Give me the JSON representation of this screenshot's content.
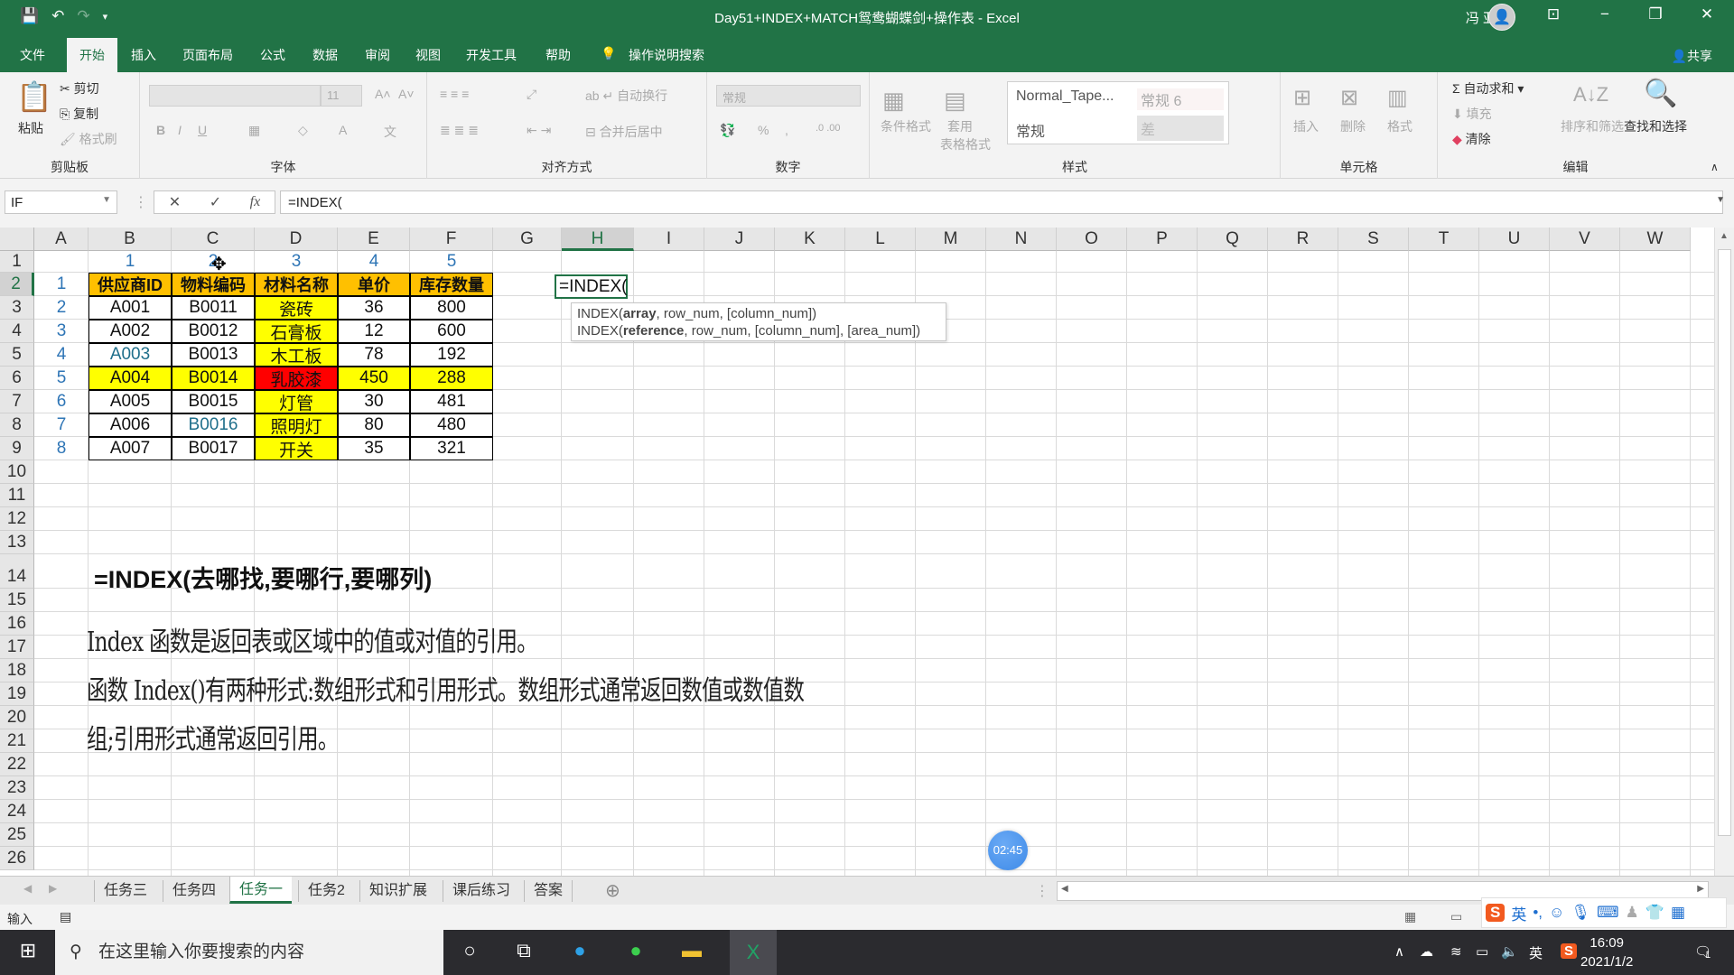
{
  "window": {
    "title": "Day51+INDEX+MATCH鸳鸯蝴蝶剑+操作表  -  Excel",
    "user": "冯 亚萍",
    "share_label": "共享"
  },
  "menu": {
    "tabs": [
      "文件",
      "开始",
      "插入",
      "页面布局",
      "公式",
      "数据",
      "审阅",
      "视图",
      "开发工具",
      "帮助"
    ],
    "active_tab": "开始",
    "search": "操作说明搜索"
  },
  "ribbon": {
    "clipboard": {
      "label": "剪贴板",
      "paste": "粘贴",
      "cut": "剪切",
      "copy": "复制",
      "format_painter": "格式刷"
    },
    "font": {
      "label": "字体",
      "size": "11",
      "bold": "B",
      "italic": "I",
      "underline": "U"
    },
    "alignment": {
      "label": "对齐方式",
      "wrap": "自动换行",
      "merge": "合并后居中"
    },
    "number": {
      "label": "数字",
      "format": "常规",
      "percent": "%",
      "comma": ","
    },
    "styles": {
      "label": "样式",
      "conditional": "条件格式",
      "table_format_1": "套用",
      "table_format_2": "表格格式",
      "style1": "Normal_Tape...",
      "style2": "常规 6",
      "style3": "常规",
      "style4": "差"
    },
    "cells": {
      "label": "单元格",
      "insert": "插入",
      "delete": "删除",
      "format": "格式"
    },
    "editing": {
      "label": "编辑",
      "autosum": "自动求和",
      "fill": "填充",
      "clear": "清除",
      "sort": "排序和筛选",
      "find": "查找和选择"
    }
  },
  "formula_bar": {
    "name_box": "IF",
    "formula": "=INDEX(",
    "fx": "fx"
  },
  "columns": [
    "A",
    "B",
    "C",
    "D",
    "E",
    "F",
    "G",
    "H",
    "I",
    "J",
    "K",
    "L",
    "M",
    "N",
    "O",
    "P",
    "Q",
    "R",
    "S",
    "T",
    "U",
    "V",
    "W"
  ],
  "rows": [
    "1",
    "2",
    "3",
    "4",
    "5",
    "6",
    "7",
    "8",
    "9",
    "10",
    "11",
    "12",
    "13",
    "14",
    "15",
    "16",
    "17",
    "18",
    "19",
    "20",
    "21",
    "22",
    "23",
    "24",
    "25",
    "26"
  ],
  "sheet": {
    "row1_numbers": [
      "1",
      "2",
      "3",
      "4",
      "5"
    ],
    "a_column_numbers": [
      "1",
      "2",
      "3",
      "4",
      "5",
      "6",
      "7",
      "8"
    ],
    "table_headers": [
      "供应商ID",
      "物料编码",
      "材料名称",
      "单价",
      "库存数量"
    ],
    "table_rows": [
      [
        "A001",
        "B0011",
        "瓷砖",
        "36",
        "800"
      ],
      [
        "A002",
        "B0012",
        "石膏板",
        "12",
        "600"
      ],
      [
        "A003",
        "B0013",
        "木工板",
        "78",
        "192"
      ],
      [
        "A004",
        "B0014",
        "乳胶漆",
        "450",
        "288"
      ],
      [
        "A005",
        "B0015",
        "灯管",
        "30",
        "481"
      ],
      [
        "A006",
        "B0016",
        "照明灯",
        "80",
        "480"
      ],
      [
        "A007",
        "B0017",
        "开关",
        "35",
        "321"
      ]
    ],
    "editing_cell": "=INDEX(",
    "tooltip_line1": {
      "fn": "INDEX(",
      "bold": "array",
      "rest": ", row_num, [column_num])"
    },
    "tooltip_line2": {
      "fn": "INDEX(",
      "bold": "reference",
      "rest": ", row_num, [column_num], [area_num])"
    },
    "syntax_note": "=INDEX(去哪找,要哪行,要哪列)",
    "para1": "Index 函数是返回表或区域中的值或对值的引用。",
    "para2": "函数 Index()有两种形式:数组形式和引用形式。数组形式通常返回数值或数值数",
    "para3": "组;引用形式通常返回引用。"
  },
  "colors": {
    "header_fill": "#ffc000",
    "highlight": "#ffff00",
    "red": "#ff0000",
    "excel_green": "#217346",
    "blue_number": "#2e75b6"
  },
  "timer": "02:45",
  "sheet_tabs": [
    "任务三",
    "任务四",
    "任务一",
    "任务2",
    "知识扩展",
    "课后练习",
    "答案"
  ],
  "active_sheet": "任务一",
  "status": {
    "mode": "输入"
  },
  "taskbar": {
    "search_placeholder": "在这里输入你要搜索的内容",
    "time": "16:09",
    "date": "2021/1/2",
    "ime": "英",
    "notifications": "1"
  }
}
